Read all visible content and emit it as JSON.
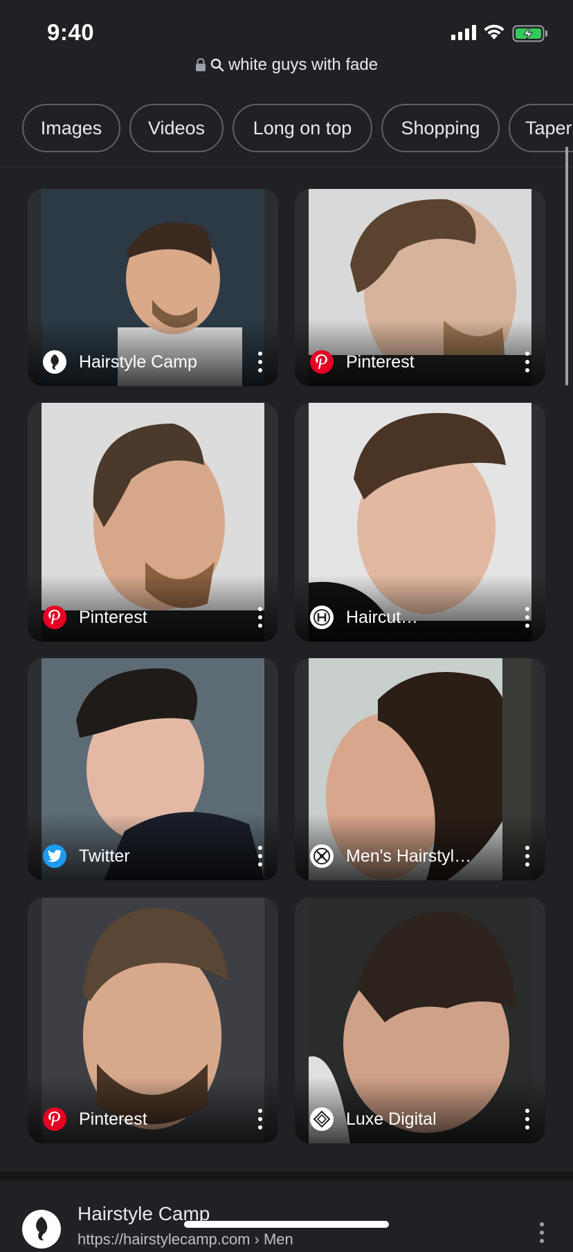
{
  "status_bar": {
    "time": "9:40"
  },
  "url_bar": {
    "query": "white guys with fade"
  },
  "chips": [
    "Images",
    "Videos",
    "Long on top",
    "Shopping",
    "Taper"
  ],
  "results": [
    {
      "source": "Hairstyle Camp",
      "favicon": "hairstylecamp-icon",
      "bg": "#2b3a45"
    },
    {
      "source": "Pinterest",
      "favicon": "pinterest-icon",
      "bg": "#d9d9d9"
    },
    {
      "source": "Pinterest",
      "favicon": "pinterest-icon",
      "bg": "#dcdcdc"
    },
    {
      "source": "Haircut…",
      "favicon": "haircut-icon",
      "bg": "#e4e4e4"
    },
    {
      "source": "Twitter",
      "favicon": "twitter-icon",
      "bg": "#5d6b74"
    },
    {
      "source": "Men's Hairstyl…",
      "favicon": "mens-hairstyles-icon",
      "bg": "#c9cfcc"
    },
    {
      "source": "Pinterest",
      "favicon": "pinterest-icon",
      "bg": "#3d3f44"
    },
    {
      "source": "Luxe Digital",
      "favicon": "luxe-digital-icon",
      "bg": "#2a2b2b"
    }
  ],
  "bottom_result": {
    "title": "Hairstyle Camp",
    "url": "https://hairstylecamp.com › Men"
  },
  "colors": {
    "background": "#202124",
    "card": "#2d2e31",
    "pinterest": "#e60023",
    "twitter": "#1d9bf0"
  }
}
